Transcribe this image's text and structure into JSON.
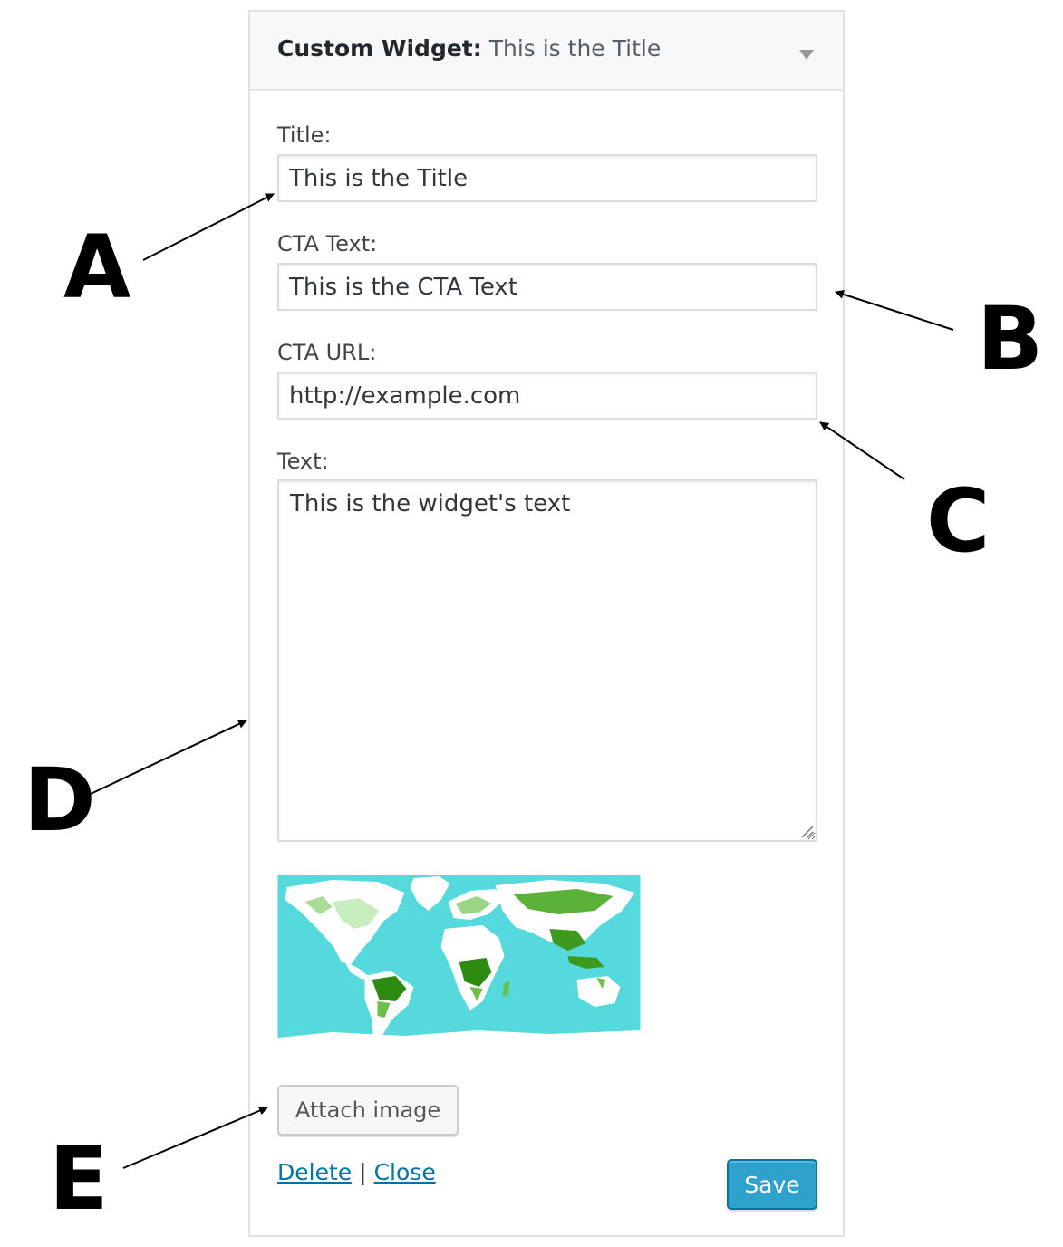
{
  "widget": {
    "name": "Custom Widget",
    "separator": ":",
    "in_title": "This is the Title",
    "toggle_icon": "triangle-down-icon"
  },
  "fields": {
    "title": {
      "label": "Title:",
      "value": "This is the Title"
    },
    "cta_text": {
      "label": "CTA Text:",
      "value": "This is the CTA Text"
    },
    "cta_url": {
      "label": "CTA URL:",
      "value": "http://example.com"
    },
    "text": {
      "label": "Text:",
      "value": "This is the widget's text"
    }
  },
  "image": {
    "description": "world-map-image"
  },
  "buttons": {
    "attach": "Attach image",
    "save": "Save"
  },
  "links": {
    "delete": "Delete",
    "separator": "|",
    "close": "Close"
  },
  "callouts": {
    "a": "A",
    "b": "B",
    "c": "C",
    "d": "D",
    "e": "E"
  },
  "colors": {
    "link": "#0073aa",
    "primary_button": "#2ea2cc",
    "map_ocean": "#55d9dc",
    "map_vegetation": "#3a9a1a"
  }
}
